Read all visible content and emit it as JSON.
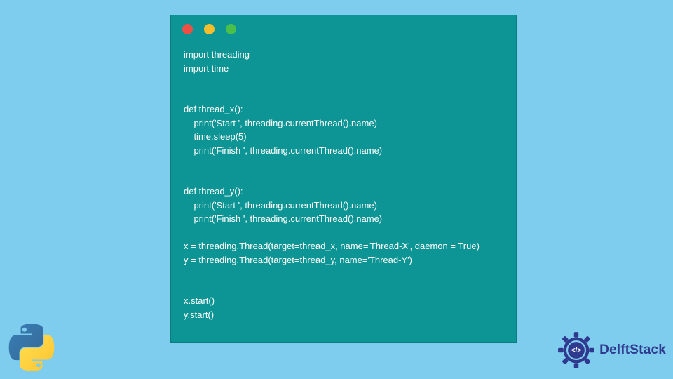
{
  "colors": {
    "page_bg": "#7fcdee",
    "window_bg": "#0d9494",
    "dot_red": "#ec5044",
    "dot_yellow": "#f6bd2d",
    "dot_green": "#4bbf4c",
    "code_text": "#ffffff",
    "brand_text": "#2f3a8f"
  },
  "code": {
    "lines": [
      "import threading",
      "import time",
      "",
      "",
      "def thread_x():",
      "    print('Start ', threading.currentThread().name)",
      "    time.sleep(5)",
      "    print('Finish ', threading.currentThread().name)",
      "",
      "",
      "def thread_y():",
      "    print('Start ', threading.currentThread().name)",
      "    print('Finish ', threading.currentThread().name)",
      "",
      "x = threading.Thread(target=thread_x, name='Thread-X', daemon = True)",
      "y = threading.Thread(target=thread_y, name='Thread-Y')",
      "",
      "",
      "x.start()",
      "y.start()"
    ]
  },
  "brand": {
    "name": "DelftStack"
  },
  "icons": {
    "python": "python-logo-icon",
    "seal": "delftstack-seal-icon"
  }
}
